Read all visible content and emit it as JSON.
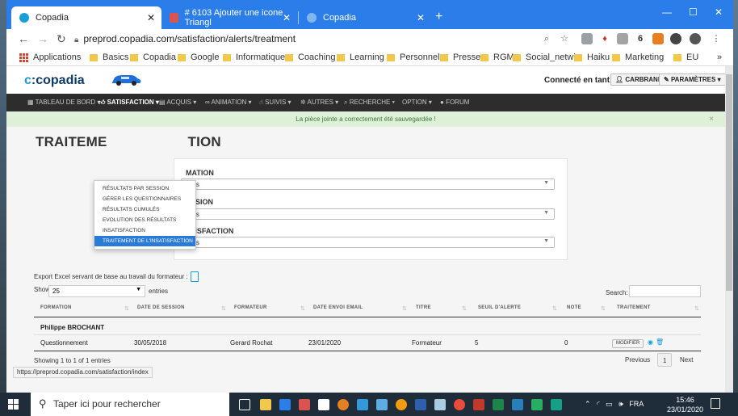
{
  "browser": {
    "tabs": [
      {
        "label": "Copadia",
        "active": true
      },
      {
        "label": "# 6103 Ajouter une icone Triangl",
        "active": false
      },
      {
        "label": "Copadia",
        "active": false
      }
    ],
    "url": "preprod.copadia.com/satisfaction/alerts/treatment",
    "bookmarks": [
      "Applications",
      "Basics",
      "Copadia",
      "Google",
      "Informatique",
      "Coaching",
      "Learning",
      "Personnel",
      "Presse",
      "RGM",
      "Social_netwk",
      "Haiku",
      "Marketing",
      "EU"
    ],
    "more_bookmarks": "»"
  },
  "site": {
    "logo_prefix": "c",
    "logo_text": "copadia",
    "connected_label": "Connecté en tant que",
    "user_button": "CARBRAND ▾",
    "settings_button": "PARAMÈTRES ▾"
  },
  "nav": {
    "items": [
      "TABLEAU DE BORD ▾",
      "SATISFACTION ▾",
      "ACQUIS ▾",
      "ANIMATION ▾",
      "SUIVIS ▾",
      "AUTRES ▾",
      "RECHERCHE ▾",
      "OPTION ▾",
      "FORUM"
    ],
    "dropdown": [
      "RÉSULTATS PAR SESSION",
      "GÉRER LES QUESTIONNAIRES",
      "RÉSULTATS CUMULÉS",
      "EVOLUTION DES RÉSULTATS",
      "INSATISFACTION",
      "TRAITEMENT DE L'INSATISFACTION"
    ]
  },
  "alert": {
    "message": "La pièce jointe a correctement été sauvegardée !",
    "close": "×"
  },
  "page": {
    "title_left": "TRAITEME",
    "title_right": "TION",
    "filters": [
      {
        "label": "MATION",
        "value": "Tous"
      },
      {
        "label": "SESSION",
        "value": "Tous"
      },
      {
        "label": "SATISFACTION",
        "value": "Tous"
      }
    ],
    "export_label": "Export Excel servant de base au travail du formateur :",
    "show_label": "Show",
    "page_length": "25",
    "entries_label": "entries",
    "search_label": "Search:"
  },
  "table": {
    "headers": [
      "FORMATION",
      "DATE DE SESSION",
      "FORMATEUR",
      "DATE ENVOI EMAIL",
      "TITRE",
      "SEUIL D'ALERTE",
      "NOTE",
      "TRAITEMENT"
    ],
    "group": "Philippe BROCHANT",
    "rows": [
      {
        "formation": "Questionnement",
        "date_session": "30/05/2018",
        "formateur": "Gerard Rochat",
        "date_email": "23/01/2020",
        "titre": "Formateur",
        "seuil": "5",
        "note": "0",
        "action": "MODIFIER"
      }
    ],
    "showing": "Showing 1 to 1 of 1 entries",
    "prev": "Previous",
    "current_page": "1",
    "next": "Next"
  },
  "status_url": "https://preprod.copadia.com/satisfaction/index",
  "taskbar": {
    "search_placeholder": "Taper ici pour rechercher",
    "lang": "FRA",
    "time": "15:46",
    "date": "23/01/2020"
  }
}
